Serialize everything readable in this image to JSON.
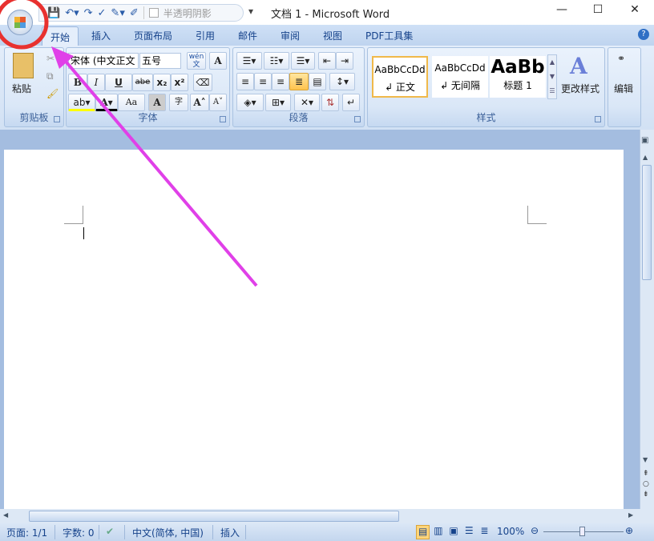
{
  "window": {
    "title": "文档 1 - Microsoft Word",
    "minimize": "—",
    "maximize": "☐",
    "close": "✕"
  },
  "qat": {
    "transparent_shadow": "半透明阴影",
    "customize": "▾"
  },
  "tabs": [
    "开始",
    "插入",
    "页面布局",
    "引用",
    "邮件",
    "审阅",
    "视图",
    "PDF工具集"
  ],
  "clipboard": {
    "paste": "粘贴",
    "label": "剪贴板"
  },
  "font": {
    "name": "宋体 (中文正文",
    "size": "五号",
    "label": "字体",
    "bold": "B",
    "italic": "I",
    "underline": "U",
    "strike": "abe",
    "sub": "x₂",
    "sup": "x²",
    "grow": "A˄",
    "shrink": "A˅",
    "case": "Aa",
    "phonetic": "wén文",
    "border_char": "A",
    "shade_char": "A",
    "enclose": "字"
  },
  "paragraph": {
    "label": "段落"
  },
  "styles": {
    "label": "样式",
    "items": [
      {
        "preview": "AaBbCcDd",
        "name": "↲ 正文"
      },
      {
        "preview": "AaBbCcDd",
        "name": "↲ 无间隔"
      },
      {
        "preview": "AaBb",
        "name": "标题 1"
      }
    ],
    "change": "更改样式"
  },
  "editing": {
    "label": "编辑"
  },
  "status": {
    "page": "页面: 1/1",
    "words": "字数: 0",
    "language": "中文(简体, 中国)",
    "mode": "插入",
    "zoom": "100%"
  },
  "colors": {
    "annotation_circle": "#e8312f",
    "annotation_arrow": "#e040e8"
  }
}
